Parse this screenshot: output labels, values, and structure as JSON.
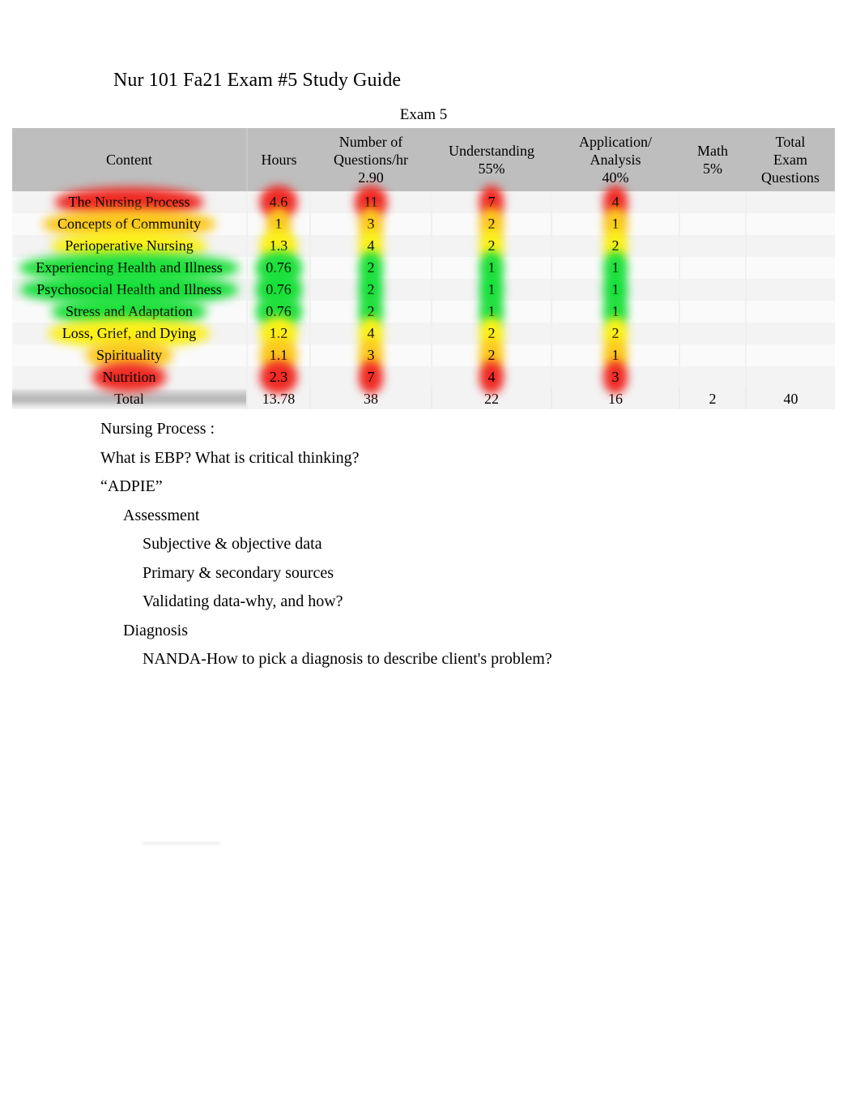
{
  "document": {
    "title": "Nur 101 Fa21 Exam #5 Study Guide"
  },
  "table": {
    "band_title": "Exam 5",
    "headers": {
      "content": "Content",
      "hours": "Hours",
      "num_questions": "Number of\nQuestions/hr\n2.90",
      "num_questions_l1": "Number of",
      "num_questions_l2": "Questions/hr",
      "num_questions_l3": "2.90",
      "understanding_l1": "Understanding",
      "understanding_l2": "55%",
      "application_l1": "Application/",
      "application_l2": "Analysis",
      "application_l3": "40%",
      "math_l1": "Math",
      "math_l2": "5%",
      "total_l1": "Total",
      "total_l2": "Exam",
      "total_l3": "Questions"
    },
    "rows": [
      {
        "content": "The Nursing Process",
        "hours": "4.6",
        "questions": "11",
        "understanding": "7",
        "application": "4",
        "math": "",
        "total": ""
      },
      {
        "content": "Concepts of Community",
        "hours": "1",
        "questions": "3",
        "understanding": "2",
        "application": "1",
        "math": "",
        "total": ""
      },
      {
        "content": "Perioperative Nursing",
        "hours": "1.3",
        "questions": "4",
        "understanding": "2",
        "application": "2",
        "math": "",
        "total": ""
      },
      {
        "content": "Experiencing Health and Illness",
        "hours": "0.76",
        "questions": "2",
        "understanding": "1",
        "application": "1",
        "math": "",
        "total": ""
      },
      {
        "content": "Psychosocial Health and Illness",
        "hours": "0.76",
        "questions": "2",
        "understanding": "1",
        "application": "1",
        "math": "",
        "total": ""
      },
      {
        "content": "Stress and Adaptation",
        "hours": "0.76",
        "questions": "2",
        "understanding": "1",
        "application": "1",
        "math": "",
        "total": ""
      },
      {
        "content": "Loss, Grief, and Dying",
        "hours": "1.2",
        "questions": "4",
        "understanding": "2",
        "application": "2",
        "math": "",
        "total": ""
      },
      {
        "content": "Spirituality",
        "hours": "1.1",
        "questions": "3",
        "understanding": "2",
        "application": "1",
        "math": "",
        "total": ""
      },
      {
        "content": "Nutrition",
        "hours": "2.3",
        "questions": "7",
        "understanding": "4",
        "application": "3",
        "math": "",
        "total": ""
      }
    ],
    "total_row": {
      "content": "Total",
      "hours": "13.78",
      "questions": "38",
      "understanding": "22",
      "application": "16",
      "math": "2",
      "total": "40"
    },
    "highlight_colors": {
      "red": "#ef2b24",
      "red_orange": "#f04a1d",
      "orange": "#f7941d",
      "yellow_orange": "#fbc81c",
      "yellow": "#faf018",
      "yellow_green": "#c9ec18",
      "green": "#1fe03c",
      "header_gray": "#bebebe",
      "row_stripe": "#f3f3f3"
    }
  },
  "body": {
    "lines": [
      {
        "text": "Nursing Process  :",
        "indent": 0
      },
      {
        "text": "What is EBP?  What is critical thinking?",
        "indent": 0
      },
      {
        "text": "“ADPIE”",
        "indent": 0
      },
      {
        "text": "Assessment",
        "indent": 1
      },
      {
        "text": "Subjective & objective data",
        "indent": 2
      },
      {
        "text": "Primary & secondary sources",
        "indent": 2
      },
      {
        "text": "Validating data-why, and how?",
        "indent": 2
      },
      {
        "text": "Diagnosis",
        "indent": 1
      },
      {
        "text": "NANDA-How to pick a diagnosis to describe client's problem?",
        "indent": 2
      }
    ]
  }
}
